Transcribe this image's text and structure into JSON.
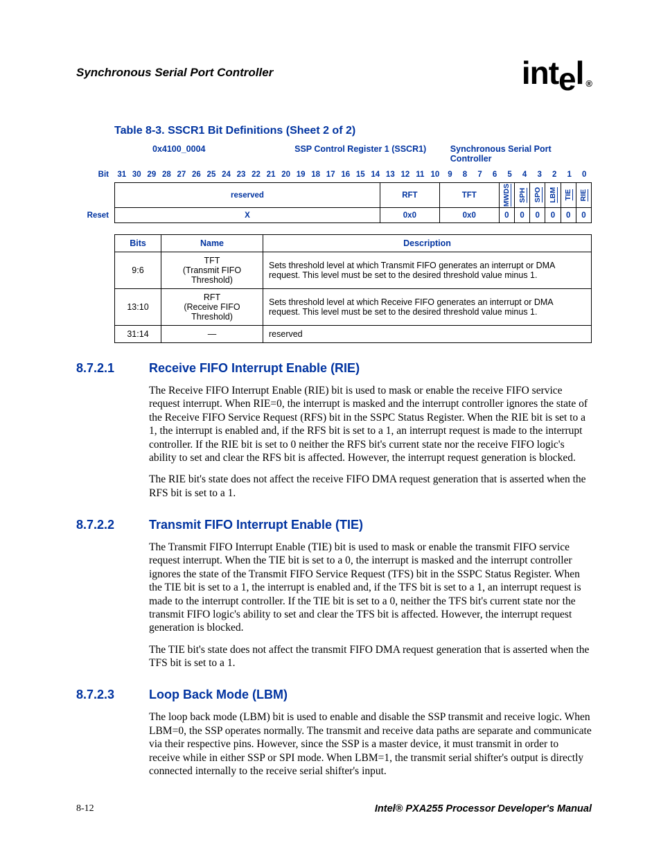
{
  "header": {
    "doc_title": "Synchronous Serial Port Controller",
    "logo_text": "intel",
    "logo_reg": "®"
  },
  "table_caption": "Table 8-3. SSCR1 Bit Definitions (Sheet 2 of 2)",
  "reg_info": {
    "address": "0x4100_0004",
    "reg_name": "SSP Control Register 1 (SSCR1)",
    "controller": "Synchronous Serial Port Controller"
  },
  "bit_label": "Bit",
  "bits": [
    "31",
    "30",
    "29",
    "28",
    "27",
    "26",
    "25",
    "24",
    "23",
    "22",
    "21",
    "20",
    "19",
    "18",
    "17",
    "16",
    "15",
    "14",
    "13",
    "12",
    "11",
    "10",
    "9",
    "8",
    "7",
    "6",
    "5",
    "4",
    "3",
    "2",
    "1",
    "0"
  ],
  "fields": {
    "reserved": "reserved",
    "rft": "RFT",
    "tft": "TFT",
    "mwds": "MWDS",
    "sph": "SPH",
    "spo": "SPO",
    "lbm": "LBM",
    "tie": "TIE",
    "rie": "RIE"
  },
  "reset_label": "Reset",
  "reset": {
    "reserved": "X",
    "rft": "0x0",
    "tft": "0x0",
    "mwds": "0",
    "sph": "0",
    "spo": "0",
    "lbm": "0",
    "tie": "0",
    "rie": "0"
  },
  "desc_headers": {
    "bits": "Bits",
    "name": "Name",
    "desc": "Description"
  },
  "desc_rows": [
    {
      "bits": "9:6",
      "name_line1": "TFT",
      "name_line2": "(Transmit FIFO Threshold)",
      "desc": "Sets threshold level at which Transmit FIFO generates an interrupt or DMA request. This level must be set to the desired threshold value minus 1."
    },
    {
      "bits": "13:10",
      "name_line1": "RFT",
      "name_line2": "(Receive FIFO Threshold)",
      "desc": "Sets threshold level at which Receive FIFO generates an interrupt or DMA request. This level must be set to the desired threshold value minus 1."
    },
    {
      "bits": "31:14",
      "name_line1": "—",
      "name_line2": "",
      "desc": "reserved"
    }
  ],
  "sections": [
    {
      "num": "8.7.2.1",
      "title": "Receive FIFO Interrupt Enable (RIE)",
      "paras": [
        "The Receive FIFO Interrupt Enable (RIE) bit is used to mask or enable the receive FIFO service request interrupt. When RIE=0, the interrupt is masked and the interrupt controller ignores the state of the Receive FIFO Service Request (RFS) bit in the SSPC Status Register. When the RIE bit is set to a 1, the interrupt is enabled and, if the RFS bit is set to a 1, an interrupt request is made to the interrupt controller. If the RIE bit is set to 0 neither the RFS bit's current state nor the receive FIFO logic's ability to set and clear the RFS bit is affected. However, the interrupt request generation is blocked.",
        "The RIE bit's state does not affect the receive FIFO DMA request generation that is asserted when the RFS bit is set to a 1."
      ]
    },
    {
      "num": "8.7.2.2",
      "title": "Transmit FIFO Interrupt Enable (TIE)",
      "paras": [
        "The Transmit FIFO Interrupt Enable (TIE) bit is used to mask or enable the transmit FIFO service request interrupt. When the TIE bit is set to a 0, the interrupt is masked and the interrupt controller ignores the state of the Transmit FIFO Service Request (TFS) bit in the SSPC Status Register. When the TIE bit is set to a 1, the interrupt is enabled and, if the TFS bit is set to a 1, an interrupt request is made to the interrupt controller. If the TIE bit is set to a 0, neither the TFS bit's current state nor the transmit FIFO logic's ability to set and clear the TFS bit is affected. However, the interrupt request generation is blocked.",
        "The TIE bit's state does not affect the transmit FIFO DMA request generation that is asserted when the TFS bit is set to a 1."
      ]
    },
    {
      "num": "8.7.2.3",
      "title": "Loop Back Mode (LBM)",
      "paras": [
        "The loop back mode (LBM) bit is used to enable and disable the SSP transmit and receive logic. When LBM=0, the SSP operates normally. The transmit and receive data paths are separate and communicate via their respective pins. However, since the SSP is a master device, it must transmit in order to receive while in either SSP or SPI mode. When LBM=1, the transmit serial shifter's output is directly connected internally to the receive serial shifter's input."
      ]
    }
  ],
  "footer": {
    "page": "8-12",
    "manual": "Intel® PXA255 Processor Developer's Manual"
  }
}
